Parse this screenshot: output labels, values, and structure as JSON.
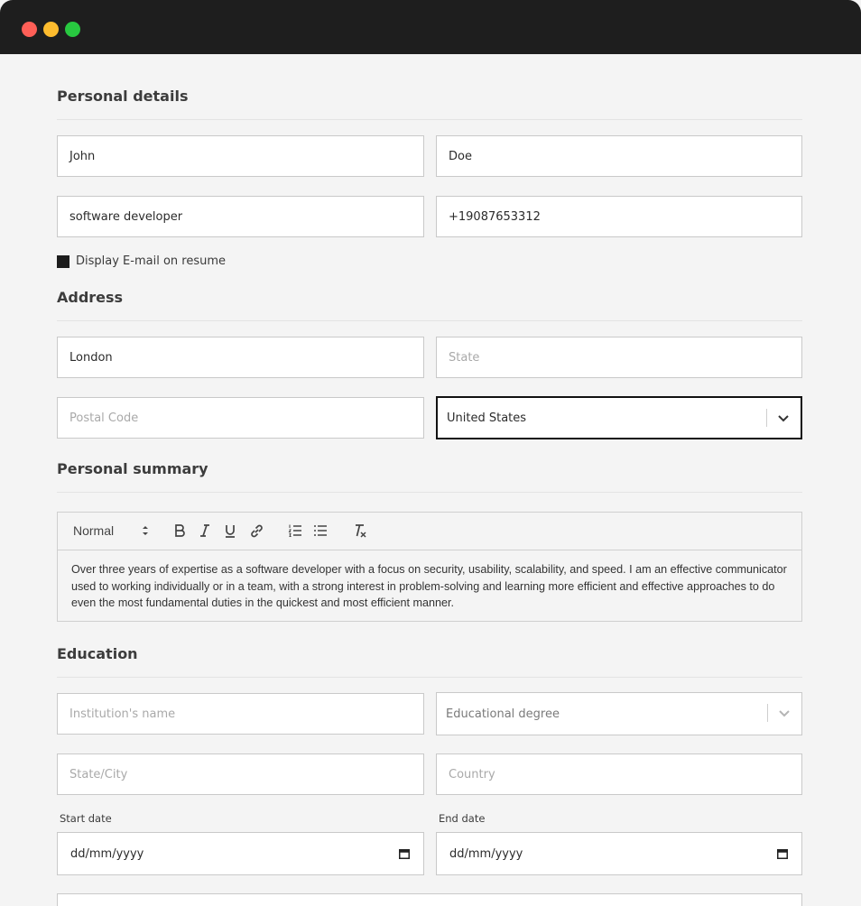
{
  "personal": {
    "title": "Personal details",
    "first_name": "John",
    "last_name": "Doe",
    "job_title": "software developer",
    "phone": "+19087653312",
    "display_email_label": "Display E-mail on resume"
  },
  "address": {
    "title": "Address",
    "city": "London",
    "state_placeholder": "State",
    "postal_placeholder": "Postal Code",
    "country": "United States"
  },
  "summary": {
    "title": "Personal summary",
    "format_label": "Normal",
    "text": "Over three years of expertise as a software developer with a focus on security, usability, scalability, and speed. I am an effective communicator used to working individually or in a team, with a strong interest in problem-solving and learning more efficient and effective approaches to do even the most fundamental duties in the quickest and most efficient manner."
  },
  "education": {
    "title": "Education",
    "institution_placeholder": "Institution's name",
    "degree_placeholder": "Educational degree",
    "state_city_placeholder": "State/City",
    "country_placeholder": "Country",
    "start_label": "Start date",
    "end_label": "End date",
    "start_value": "dd/mm/yyyy",
    "end_value": "dd/mm/yyyy"
  },
  "icons": {
    "chevron": "chevron-down-icon",
    "calendar": "calendar-icon"
  },
  "colors": {
    "titlebar": "#1e1e1e",
    "background": "#f4f4f4",
    "close": "#ff5f57",
    "minimize": "#febc2e",
    "maximize": "#28c840"
  }
}
